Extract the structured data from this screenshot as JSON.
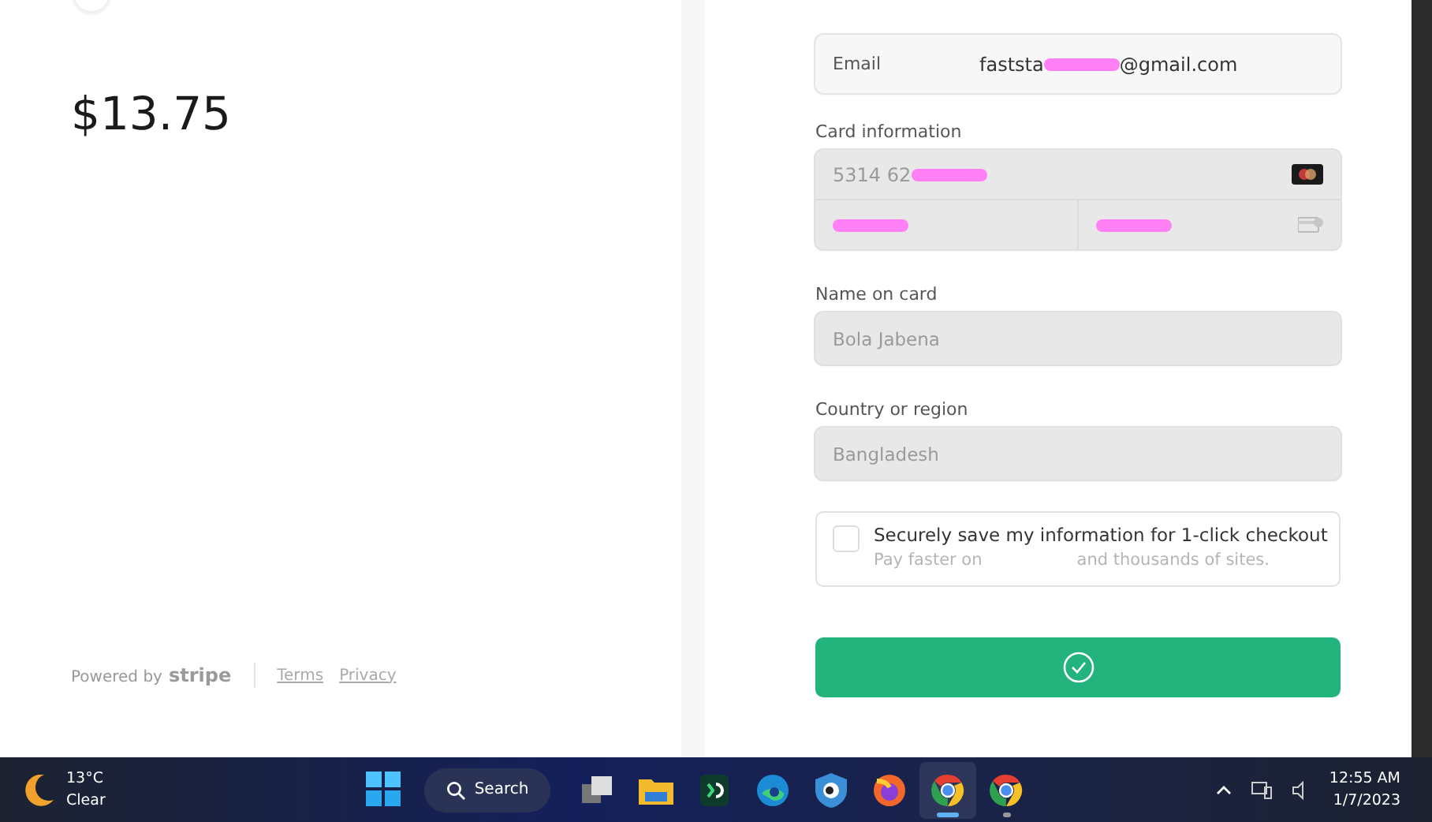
{
  "summary": {
    "amount": "$13.75"
  },
  "footer": {
    "powered_by": "Powered by",
    "brand": "stripe",
    "links": [
      "Terms",
      "Privacy"
    ]
  },
  "form": {
    "email": {
      "label": "Email",
      "segments": [
        {
          "kind": "text",
          "text": "faststa"
        },
        {
          "kind": "redaction"
        },
        {
          "kind": "text",
          "text": "@gmail.com"
        }
      ]
    },
    "card_label": "Card information",
    "card_number": {
      "disabled": true,
      "segments": [
        {
          "kind": "text",
          "text": "5314 62"
        },
        {
          "kind": "redaction"
        }
      ]
    },
    "expiry": {
      "disabled": true,
      "segments": [
        {
          "kind": "redaction"
        }
      ]
    },
    "cvc": {
      "disabled": true,
      "segments": [
        {
          "kind": "redaction"
        }
      ]
    },
    "name": {
      "label": "Name on card",
      "value": "Bola Jabena",
      "disabled": true
    },
    "country": {
      "label": "Country or region",
      "value": "Bangladesh",
      "disabled": true
    },
    "save": {
      "checked": false,
      "title": "Securely save my information for 1-click checkout",
      "hint_start": "Pay faster on",
      "hint_end": "and thousands of sites."
    },
    "submit": {
      "success": true
    }
  },
  "taskbar": {
    "weather": {
      "temp": "13°C",
      "condition": "Clear"
    },
    "search": "Search",
    "apps": [
      {
        "kind": "taskview",
        "active": false
      },
      {
        "kind": "folder",
        "active": false
      },
      {
        "kind": "terminal",
        "active": false
      },
      {
        "kind": "edge",
        "active": false
      },
      {
        "kind": "shield",
        "active": false
      },
      {
        "kind": "firefox",
        "active": false
      },
      {
        "kind": "chrome",
        "active": true
      },
      {
        "kind": "chrome",
        "active": false
      }
    ],
    "time": "12:55 AM",
    "date": "1/7/2023"
  }
}
